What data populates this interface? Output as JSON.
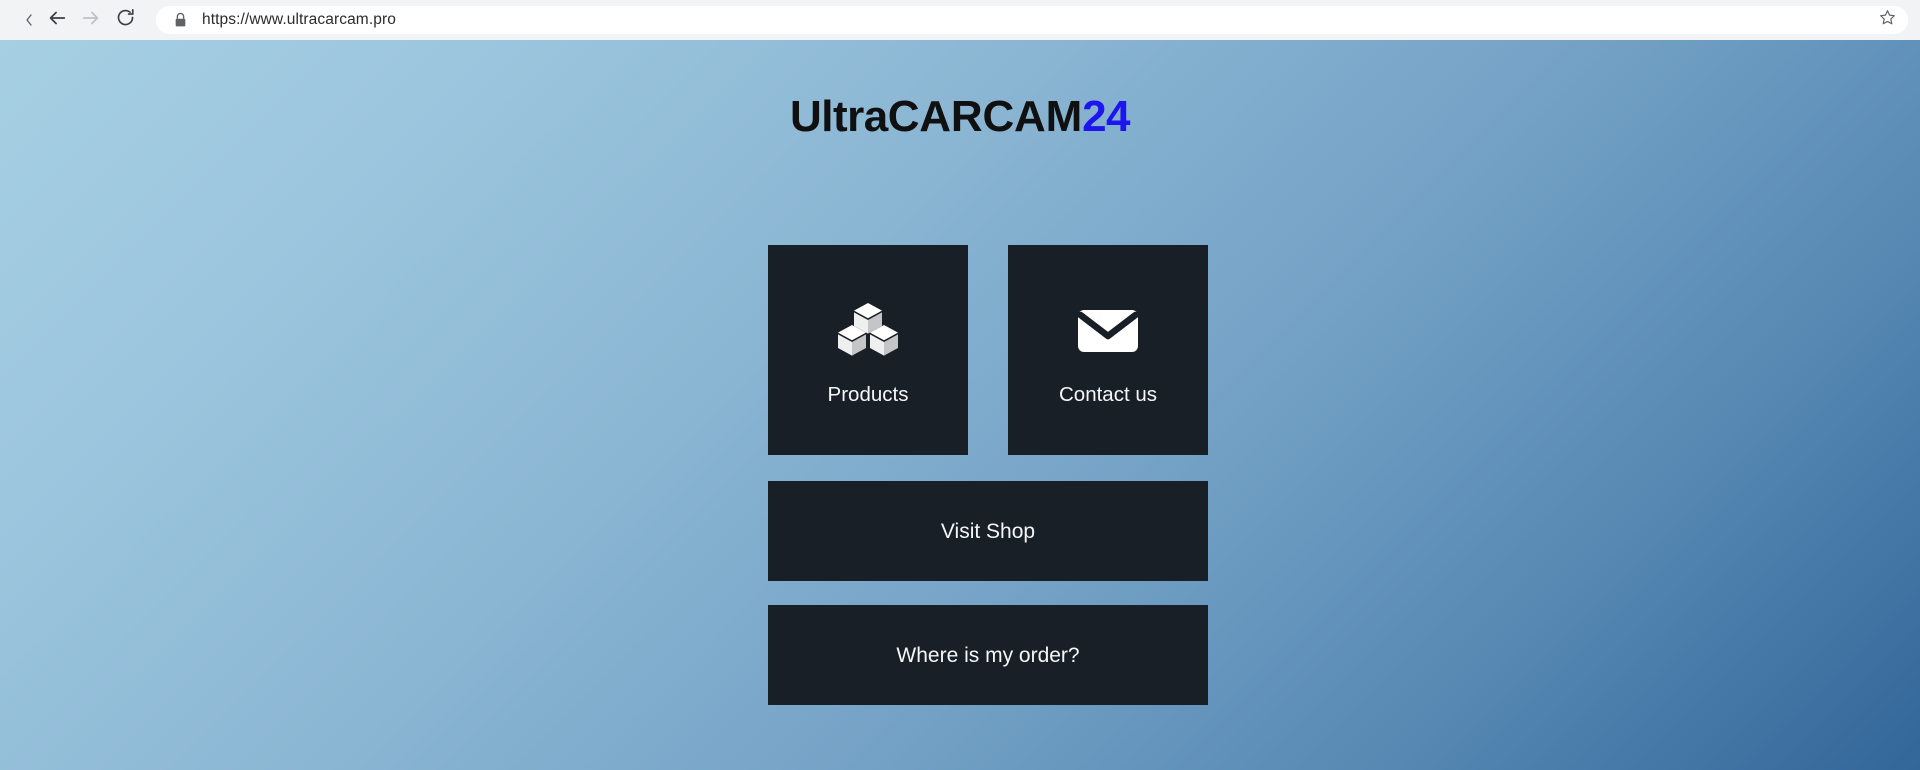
{
  "browser": {
    "back_icon": "back-arrow-icon",
    "forward_icon": "forward-arrow-icon",
    "reload_icon": "reload-icon",
    "tab_chevron_icon": "chevron-left-icon",
    "lock_icon": "lock-icon",
    "bookmark_icon": "star-outline-icon",
    "url": "https://www.ultracarcam.pro",
    "url_placeholder": "Search Google or type a URL",
    "chrome_bg": "#f1f3f4",
    "omnibox_bg": "#ffffff"
  },
  "page": {
    "background_top_left": "#a6cfe3",
    "background_bottom_right": "#336699",
    "logo": {
      "part1": "Ultra",
      "part2": "CARCAM",
      "part3": "24",
      "part3_color": "#1d14ef",
      "text_color": "#101010"
    },
    "tile_bg": "#191f27",
    "tile_text_color": "#f4f6f8",
    "tiles": [
      {
        "label": "Products",
        "icon": "boxes-icon"
      },
      {
        "label": "Contact us",
        "icon": "envelope-icon"
      }
    ],
    "buttons": [
      {
        "label": "Visit Shop"
      },
      {
        "label": "Where is my order?"
      }
    ]
  }
}
